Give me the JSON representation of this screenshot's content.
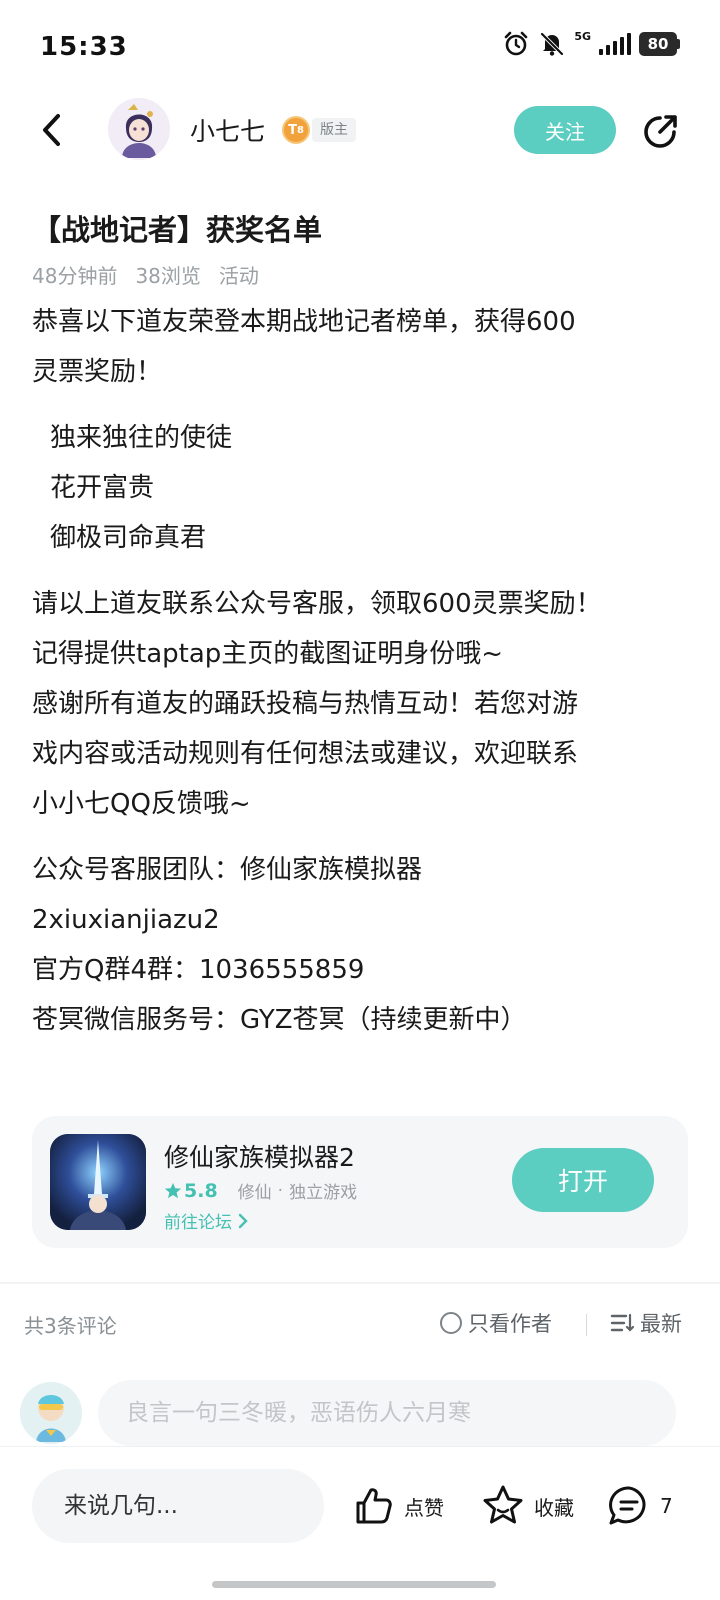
{
  "status_bar": {
    "time": "15:33",
    "network": "5G",
    "battery": "80",
    "icons": [
      "alarm-icon",
      "mute-bell-icon",
      "signal-icon",
      "battery-icon"
    ]
  },
  "header": {
    "author_name": "小七七",
    "level": "8",
    "role": "版主",
    "follow_label": "关注",
    "icons": [
      "back-arrow-icon",
      "share-icon"
    ]
  },
  "post": {
    "title": "【战地记者】获奖名单",
    "meta": {
      "time": "48分钟前",
      "views": "38浏览",
      "category": "活动"
    },
    "intro_line1": "恭喜以下道友荣登本期战地记者榜单，获得600",
    "intro_line2": "灵票奖励！",
    "winners": [
      "独来独往的使徒",
      "花开富贵",
      "御极司命真君"
    ],
    "p2": [
      "请以上道友联系公众号客服，领取600灵票奖励！",
      "记得提供taptap主页的截图证明身份哦~",
      "感谢所有道友的踊跃投稿与热情互动！若您对游",
      "戏内容或活动规则有任何想法或建议，欢迎联系",
      "小小七QQ反馈哦~"
    ],
    "p3": [
      "公众号客服团队：修仙家族模拟器",
      "2xiuxianjiazu2",
      "官方Q群4群：1036555859",
      "苍冥微信服务号：GYZ苍冥（持续更新中）"
    ]
  },
  "game_card": {
    "name": "修仙家族模拟器2",
    "rating": "5.8",
    "tag1": "修仙",
    "dot": "·",
    "tag2": "独立游戏",
    "forum_link": "前往论坛",
    "open_label": "打开",
    "accent": "#5ccdc1"
  },
  "comments": {
    "count_label": "共3条评论",
    "author_only_label": "只看作者",
    "sort_label": "最新",
    "input_placeholder": "良言一句三冬暖，恶语伤人六月寒"
  },
  "bottom_bar": {
    "quick_reply": "来说几句...",
    "like_label": "点赞",
    "favorite_label": "收藏",
    "comment_count": "7"
  }
}
